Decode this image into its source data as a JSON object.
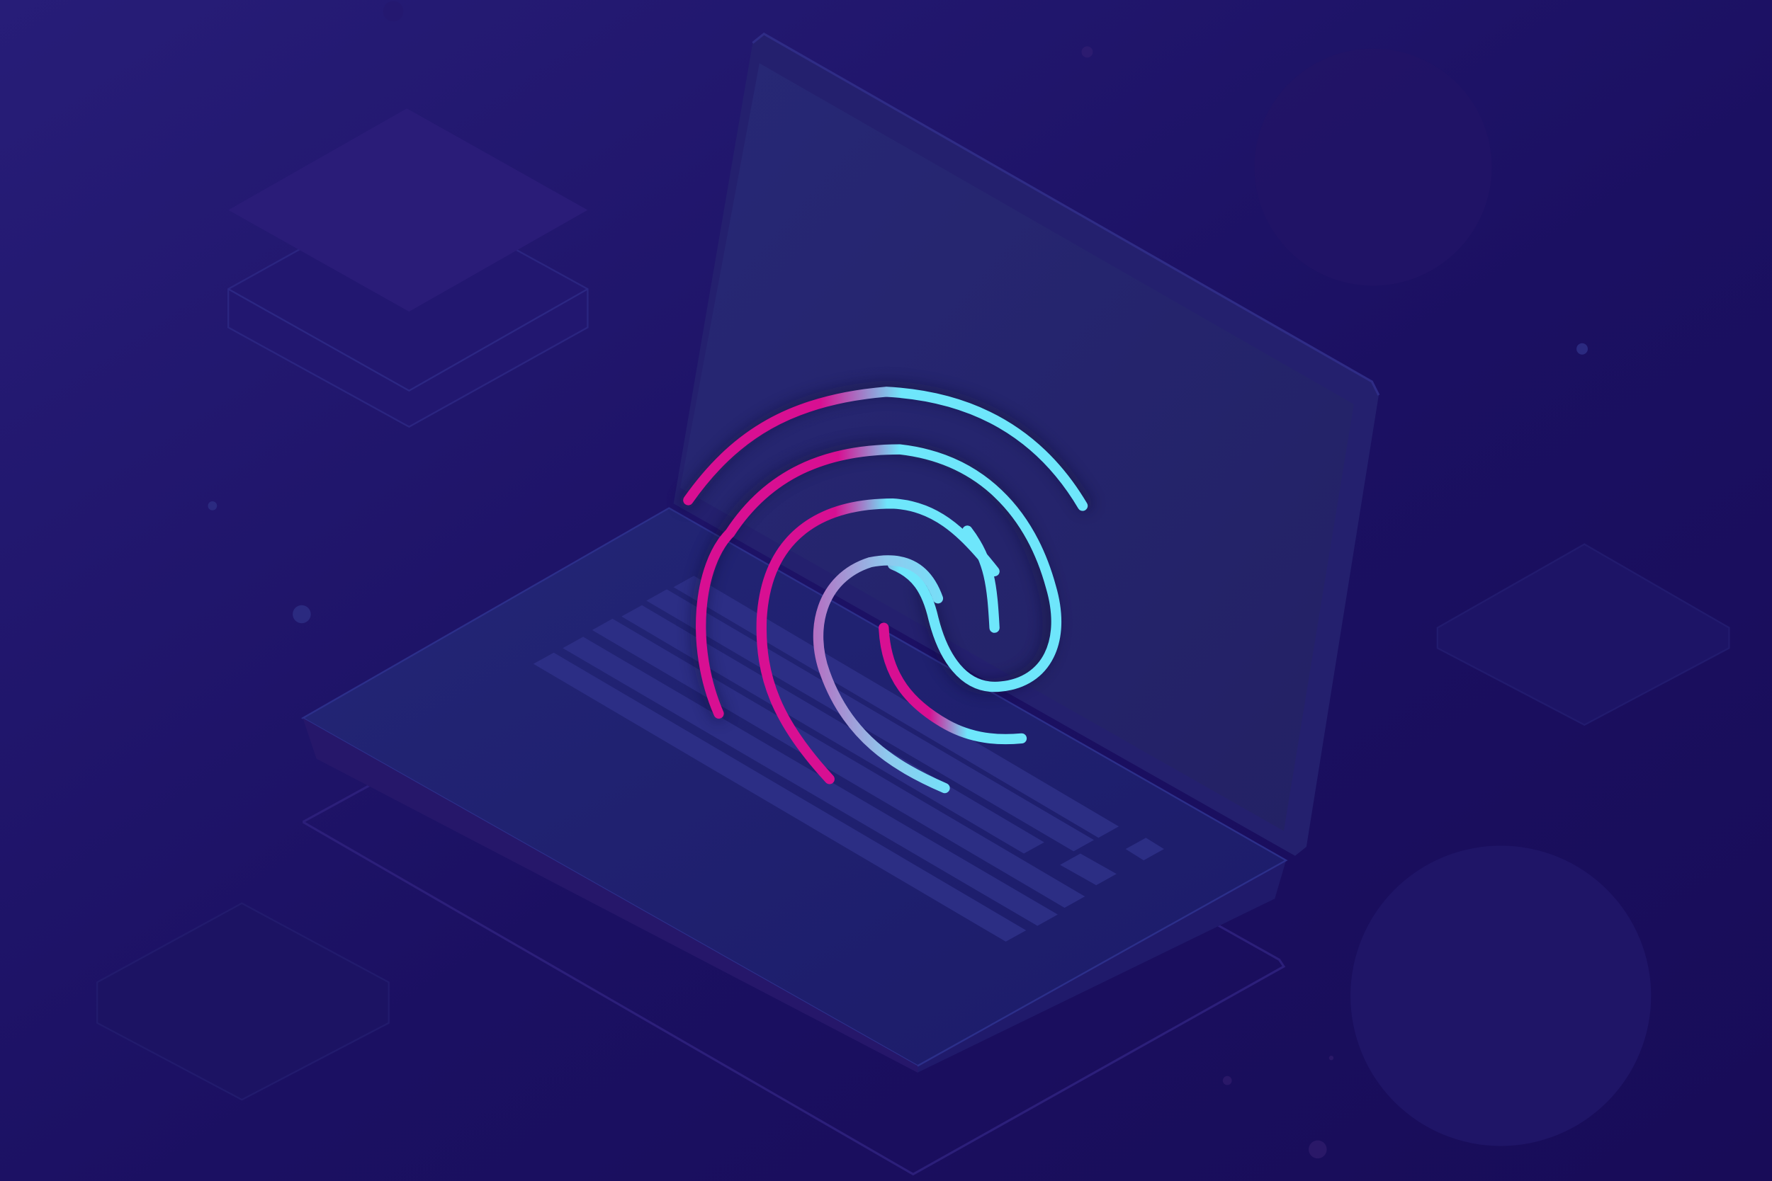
{
  "illustration": {
    "subject": "fingerprint-over-laptop",
    "icon": "fingerprint-icon",
    "palette": {
      "background_light": "#2a1f7a",
      "background_dark": "#170c55",
      "laptop_body": "#23237a",
      "laptop_screen": "#25256f",
      "laptop_edge": "#2e2c8a",
      "keyboard_lines": "#2f3189",
      "fingerprint_magenta": "#d80f92",
      "fingerprint_cyan": "#6ee6fb",
      "decor_purple": "#2a1b7a"
    }
  }
}
